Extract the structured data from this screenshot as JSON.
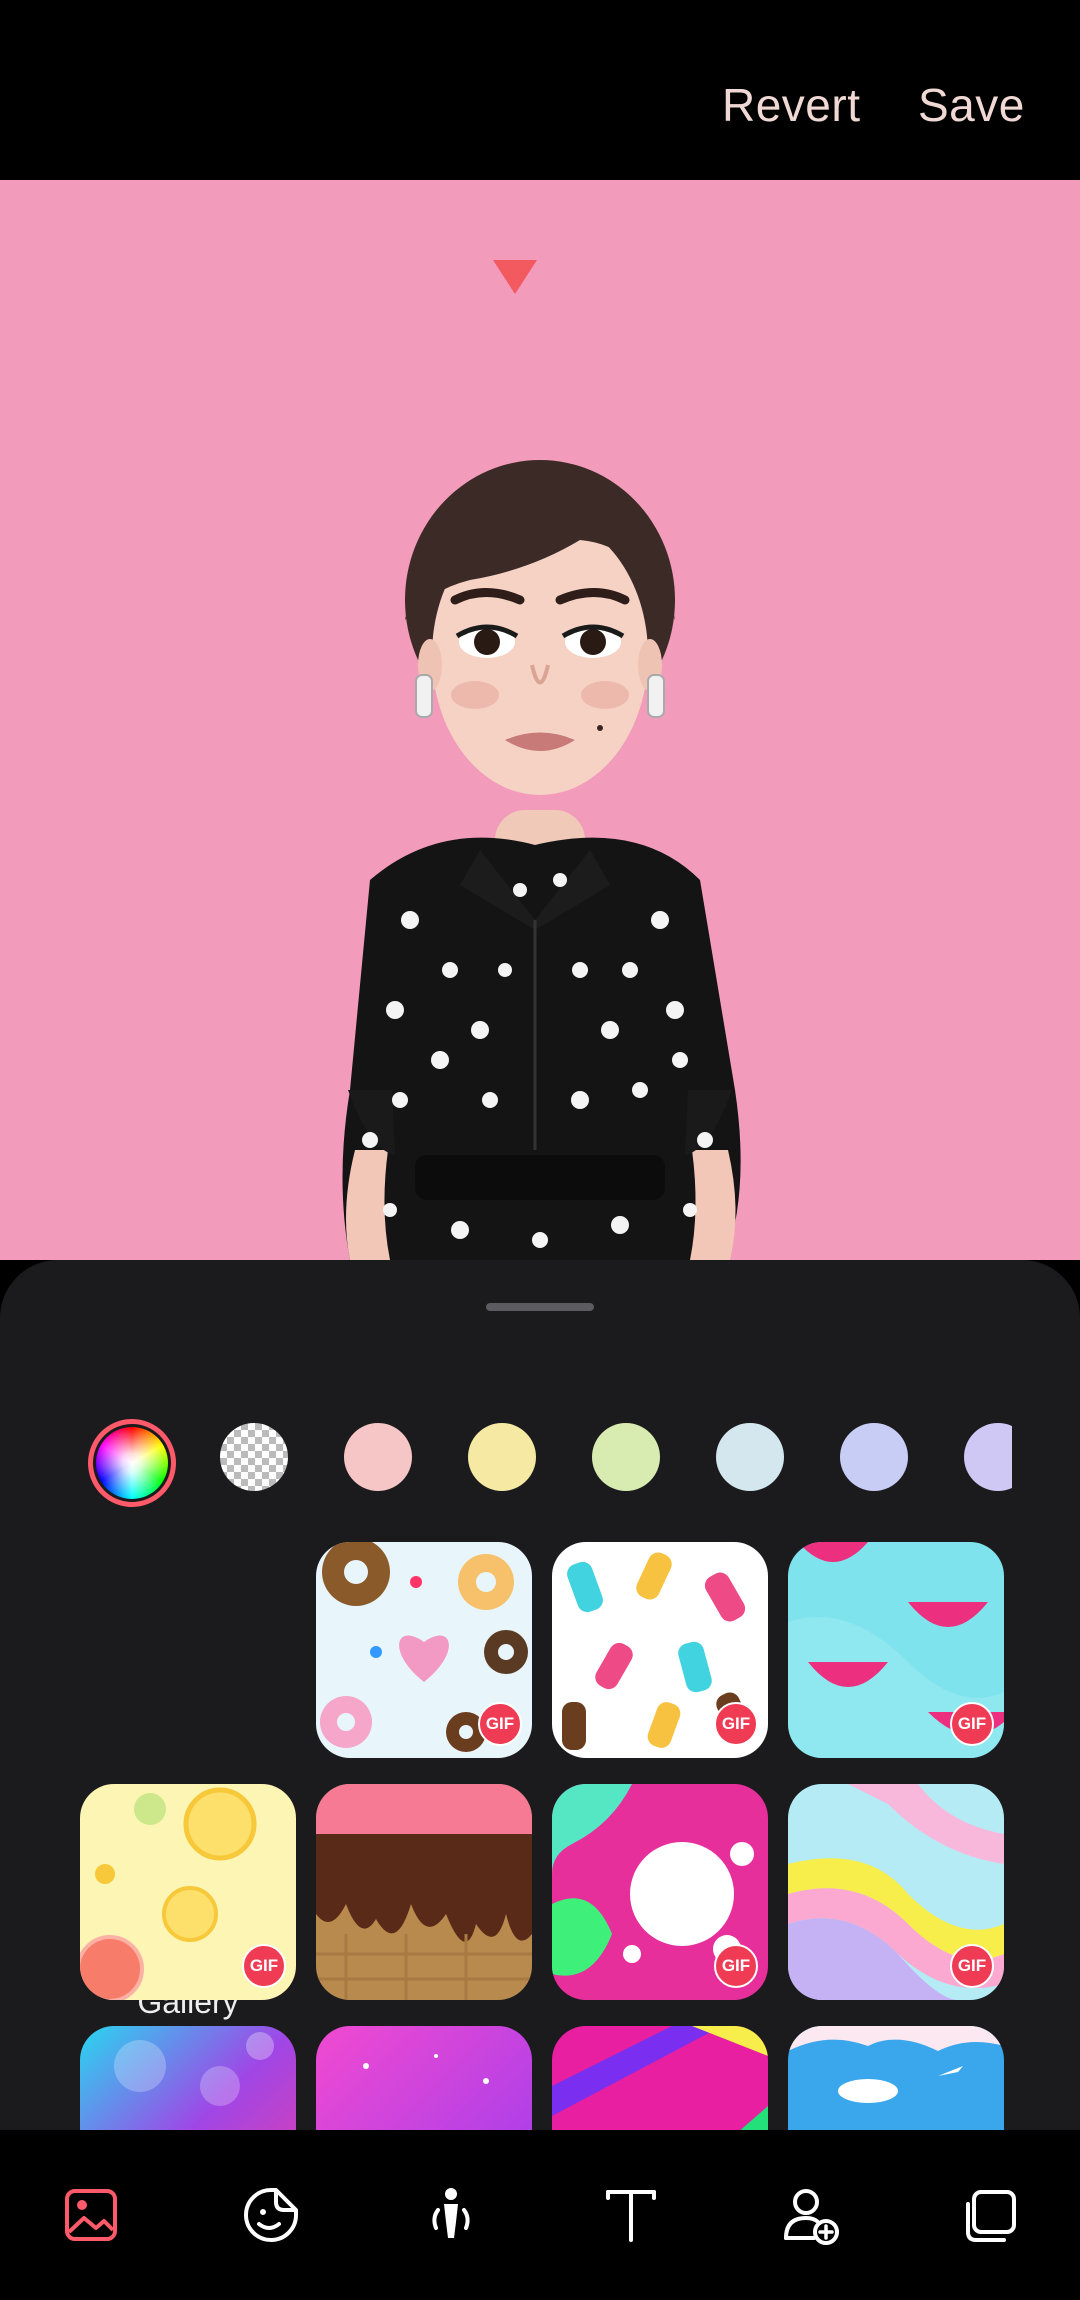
{
  "header": {
    "revert_label": "Revert",
    "save_label": "Save"
  },
  "colors": {
    "accent": "#ff5a69",
    "preview_bg": "#f29bbb",
    "sheet_bg": "#1b1b1d"
  },
  "swatches": [
    {
      "name": "color-wheel",
      "color": "rainbow",
      "selected": true
    },
    {
      "name": "transparent",
      "color": "transparent"
    },
    {
      "name": "pink",
      "color": "#f6c6c7"
    },
    {
      "name": "yellow",
      "color": "#f5e9a3"
    },
    {
      "name": "green",
      "color": "#d8ecb1"
    },
    {
      "name": "light-blue",
      "color": "#d4e7ee"
    },
    {
      "name": "periwinkle",
      "color": "#c8cdf5"
    },
    {
      "name": "lavender",
      "color": "#cfc8f5"
    }
  ],
  "gallery": {
    "label": "Gallery"
  },
  "backgrounds": [
    {
      "name": "donuts",
      "gif": true
    },
    {
      "name": "ice-cream",
      "gif": true
    },
    {
      "name": "watermelon",
      "gif": true
    },
    {
      "name": "citrus",
      "gif": true
    },
    {
      "name": "chocolate-drip",
      "gif": true
    },
    {
      "name": "paint-splash",
      "gif": true
    },
    {
      "name": "rainbow-stripes",
      "gif": true
    },
    {
      "name": "bokeh",
      "gif": false
    },
    {
      "name": "pink-sparkle",
      "gif": false
    },
    {
      "name": "neon-streaks",
      "gif": false
    },
    {
      "name": "sky-plane",
      "gif": false
    }
  ],
  "gif_badge_text": "GIF",
  "bottom_nav": [
    {
      "icon": "background-image-icon",
      "active": true
    },
    {
      "icon": "sticker-icon",
      "active": false
    },
    {
      "icon": "pose-icon",
      "active": false
    },
    {
      "icon": "text-icon",
      "active": false
    },
    {
      "icon": "add-person-icon",
      "active": false
    },
    {
      "icon": "layers-icon",
      "active": false
    }
  ]
}
